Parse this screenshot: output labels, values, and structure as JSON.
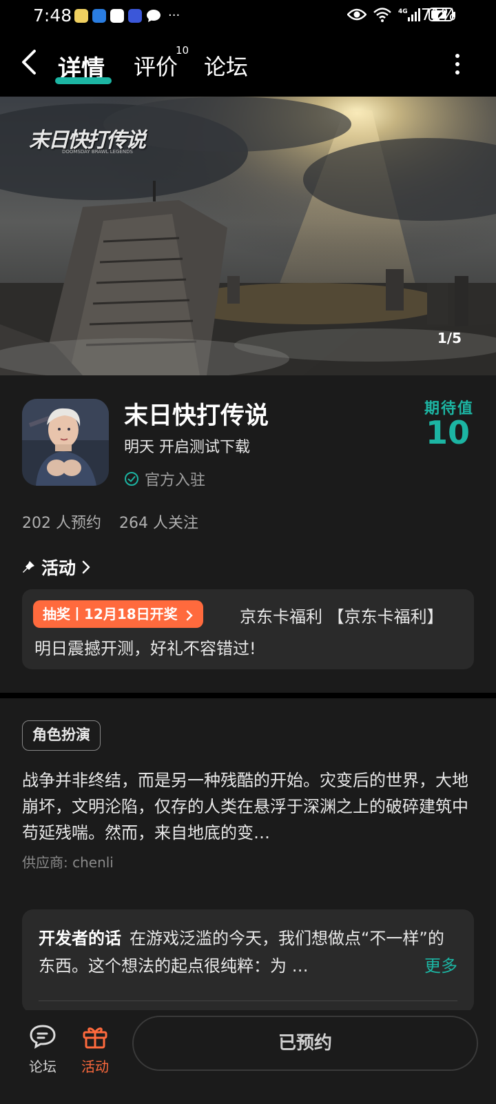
{
  "status_bar": {
    "time": "7:48",
    "more": "···",
    "battery_percent": "71%",
    "network": "4G"
  },
  "nav": {
    "tabs": [
      {
        "label": "详情",
        "active": true
      },
      {
        "label": "评价",
        "badge": "10"
      },
      {
        "label": "论坛"
      }
    ]
  },
  "banner": {
    "logo_text": "末日快打传说",
    "logo_sub": "DOOMSDAY BRAWL LEGENDS",
    "counter": "1/5"
  },
  "game": {
    "title": "末日快打传说",
    "subtitle": "明天 开启测试下载",
    "official_label": "官方入驻",
    "expect_label": "期待值",
    "expect_value": "10",
    "reservations": "202 人预约",
    "followers": "264 人关注"
  },
  "activity": {
    "heading": "活动",
    "tag": "抽奖丨12月18日开奖",
    "line1": "京东卡福利 【京东卡福利】",
    "line2": "明日震撼开测，好礼不容错过!"
  },
  "details": {
    "genre": "角色扮演",
    "description": "战争并非终结，而是另一种残酷的开始。灾变后的世界，大地崩坏，文明沦陷，仅存的人类在悬浮于深渊之上的破碎建筑中苟延残喘。然而，来自地底的变…",
    "supplier": "供应商: chenli"
  },
  "developer": {
    "label": "开发者的话",
    "text": "在游戏泛滥的今天，我们想做点“不一样”的东西。这个想法的起点很纯粹：为 …",
    "more": "更多"
  },
  "bottom_bar": {
    "forum_label": "论坛",
    "activity_label": "活动",
    "reserve_label": "已预约"
  },
  "colors": {
    "accent": "#1cb5a3",
    "activity": "#ff6a3d",
    "background": "#1b1b1b"
  }
}
